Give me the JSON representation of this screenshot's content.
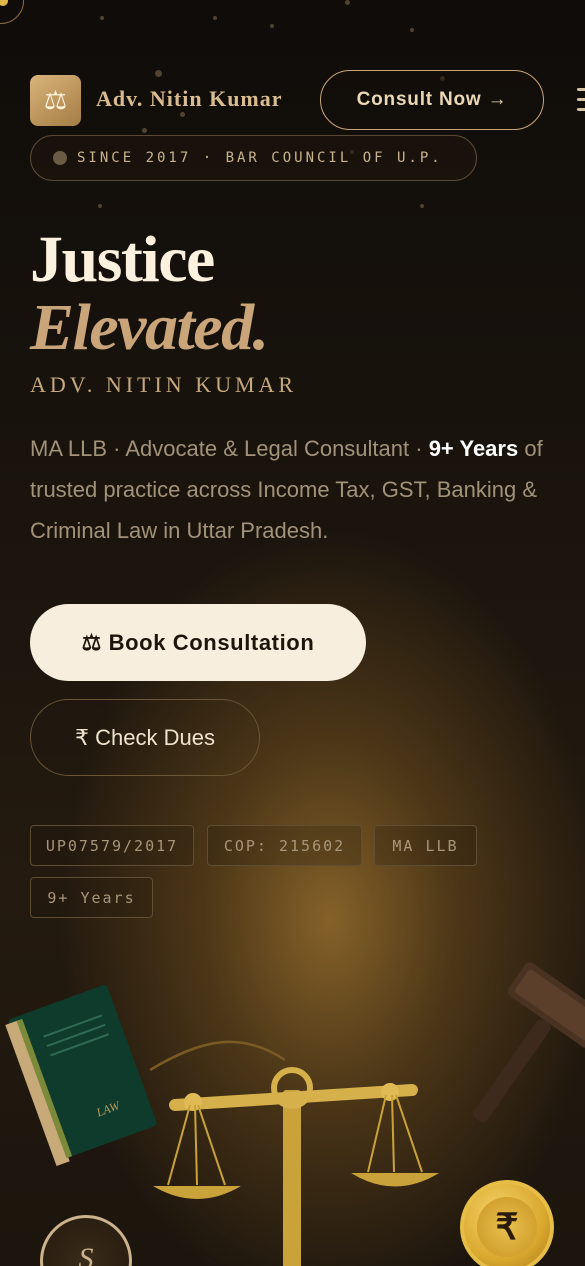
{
  "header": {
    "logo_glyph": "⚖",
    "brand_name": "Adv. Nitin Kumar",
    "consult_label": "Consult Now →"
  },
  "badge": {
    "text": "SINCE 2017 · BAR COUNCIL OF U.P."
  },
  "hero": {
    "title_line1": "Justice",
    "title_line2": "Elevated.",
    "subtitle": "ADV. NITIN KUMAR",
    "desc_before": "MA LLB · Advocate & Legal Consultant · ",
    "desc_highlight": "9+ Years",
    "desc_after": " of trusted practice across Income Tax, GST, Banking & Criminal Law in Uttar Pradesh."
  },
  "actions": {
    "book_label": "⚖ Book Consultation",
    "dues_label": "₹ Check Dues"
  },
  "tags": [
    "UP07579/2017",
    "COP: 215602",
    "MA LLB",
    "9+ Years"
  ],
  "illustration": {
    "book_label": "LAW",
    "coin_glyph": "₹",
    "seal_glyph": "S"
  },
  "colors": {
    "accent_gold": "#caa57a",
    "primary_button": "#f7eedd",
    "background": "#1a140d"
  }
}
